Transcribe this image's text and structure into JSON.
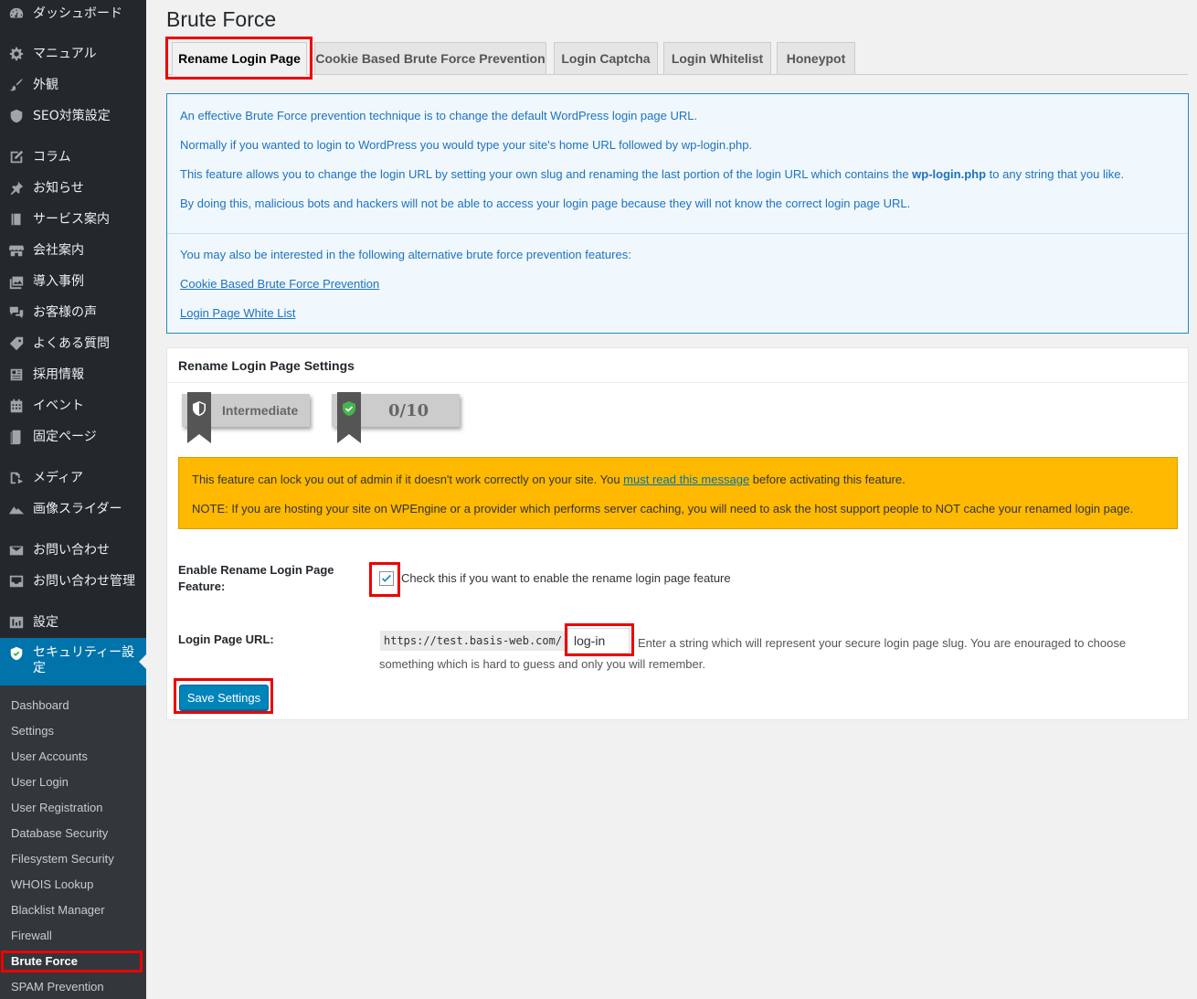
{
  "sidebar": {
    "items": [
      {
        "label": "ダッシュボード",
        "icon": "dashboard-icon"
      },
      {
        "label": "マニュアル",
        "icon": "gear-icon"
      },
      {
        "label": "外観",
        "icon": "paintbrush-icon"
      },
      {
        "label": "SEO対策設定",
        "icon": "shield-icon"
      },
      {
        "label": "コラム",
        "icon": "edit-icon"
      },
      {
        "label": "お知らせ",
        "icon": "pin-icon"
      },
      {
        "label": "サービス案内",
        "icon": "book-icon"
      },
      {
        "label": "会社案内",
        "icon": "store-icon"
      },
      {
        "label": "導入事例",
        "icon": "gallery-icon"
      },
      {
        "label": "お客様の声",
        "icon": "comments-icon"
      },
      {
        "label": "よくある質問",
        "icon": "tag-icon"
      },
      {
        "label": "採用情報",
        "icon": "id-card-icon"
      },
      {
        "label": "イベント",
        "icon": "calendar-icon"
      },
      {
        "label": "固定ページ",
        "icon": "page-icon"
      },
      {
        "label": "メディア",
        "icon": "media-icon"
      },
      {
        "label": "画像スライダー",
        "icon": "mountain-icon"
      },
      {
        "label": "お問い合わせ",
        "icon": "email-icon"
      },
      {
        "label": "お問い合わせ管理",
        "icon": "inbox-icon"
      },
      {
        "label": "設定",
        "icon": "settings-icon"
      },
      {
        "label": "セキュリティー設定",
        "icon": "security-shield-icon"
      }
    ],
    "submenu": [
      "Dashboard",
      "Settings",
      "User Accounts",
      "User Login",
      "User Registration",
      "Database Security",
      "Filesystem Security",
      "WHOIS Lookup",
      "Blacklist Manager",
      "Firewall",
      "Brute Force",
      "SPAM Prevention"
    ]
  },
  "page": {
    "title": "Brute Force",
    "tabs": [
      "Rename Login Page",
      "Cookie Based Brute Force Prevention",
      "Login Captcha",
      "Login Whitelist",
      "Honeypot"
    ]
  },
  "info": {
    "line1": "An effective Brute Force prevention technique is to change the default WordPress login page URL.",
    "line2": "Normally if you wanted to login to WordPress you would type your site's home URL followed by wp-login.php.",
    "line3_pre": "This feature allows you to change the login URL by setting your own slug and renaming the last portion of the login URL which contains the ",
    "line3_strong": "wp-login.php",
    "line3_post": " to any string that you like.",
    "line4": "By doing this, malicious bots and hackers will not be able to access your login page because they will not know the correct login page URL.",
    "line5": "You may also be interested in the following alternative brute force prevention features:",
    "link1": "Cookie Based Brute Force Prevention",
    "link2": "Login Page White List"
  },
  "settings": {
    "header": "Rename Login Page Settings",
    "badge_level": "Intermediate",
    "badge_score": "0/10",
    "warn_pre": "This feature can lock you out of admin if it doesn't work correctly on your site. You ",
    "warn_link": "must read this message",
    "warn_post": " before activating this feature.",
    "warn_note": "NOTE: If you are hosting your site on WPEngine or a provider which performs server caching, you will need to ask the host support people to NOT cache your renamed login page.",
    "enable_label": "Enable Rename Login Page Feature:",
    "enable_checked": true,
    "enable_desc": "Check this if you want to enable the rename login page feature",
    "url_label": "Login Page URL:",
    "url_prefix": "https://test.basis-web.com/",
    "url_value": "log-in",
    "url_desc": "Enter a string which will represent your secure login page slug. You are enouraged to choose something which is hard to guess and only you will remember.",
    "save_label": "Save Settings"
  },
  "colors": {
    "sidebar_bg": "#23282d",
    "active_menu": "#0073aa",
    "info_text": "#1e73be",
    "warning_bg": "#ffb900",
    "highlight": "#ee0000",
    "button": "#0085ba"
  }
}
